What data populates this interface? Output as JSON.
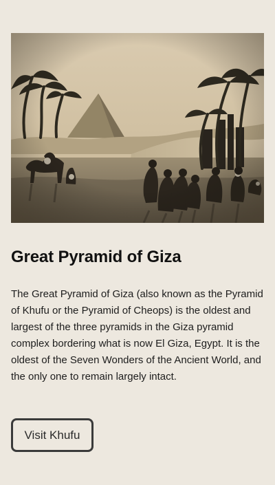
{
  "article": {
    "image_alt": "Great Pyramid of Giza",
    "title": "Great Pyramid of Giza",
    "description": "The Great Pyramid of Giza (also known as the Pyramid of Khufu or the Pyramid of Cheops) is the oldest and largest of the three pyramids in the Giza pyramid complex bordering what is now El Giza, Egypt. It is the oldest of the Seven Wonders of the Ancient World, and the only one to remain largely intact.",
    "button_label": "Visit Khufu"
  },
  "colors": {
    "page_background": "#ede8df",
    "text": "#161616",
    "button_border": "#3a3a3a",
    "photo_tone": "#b9ab8e"
  }
}
